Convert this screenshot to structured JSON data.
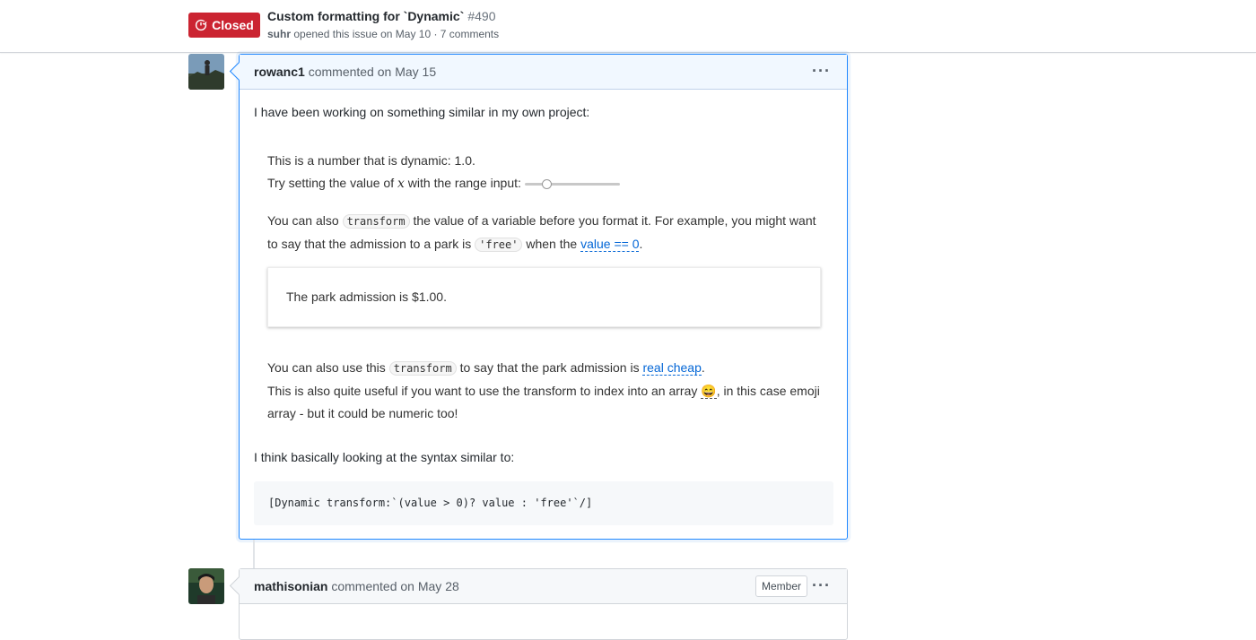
{
  "header": {
    "state": "Closed",
    "title": "Custom formatting for `Dynamic`",
    "number": "#490",
    "author": "suhr",
    "meta_rest": "opened this issue on May 10 · 7 comments"
  },
  "comments": [
    {
      "author": "rowanc1",
      "action": "commented on May 15",
      "intro": "I have been working on something similar in my own project:",
      "embed": {
        "line1": "This is a number that is dynamic: 1.0.",
        "line2_pre": "Try setting the value of ",
        "line2_var": "x",
        "line2_post": " with the range input:",
        "slider_value": 0.2,
        "p2_a": "You can also ",
        "p2_code1": "transform",
        "p2_b": " the value of a variable before you format it. For example, you might want to say that the admission to a park is ",
        "p2_code2": "'free'",
        "p2_c": " when the ",
        "p2_link": "value == 0",
        "p2_d": ".",
        "admission": "The park admission is $1.00.",
        "p3_a": "You can also use this ",
        "p3_code": "transform",
        "p3_b": " to say that the park admission is ",
        "p3_link": "real cheap",
        "p3_c": ".",
        "p4_a": "This is also quite useful if you want to use the transform to index into an array ",
        "p4_emoji": "😄",
        "p4_b": ", in this case emoji array - but it could be numeric too!"
      },
      "syntax_intro": "I think basically looking at the syntax similar to:",
      "code": "[Dynamic transform:`(value > 0)? value : 'free'`/]"
    },
    {
      "author": "mathisonian",
      "action": "commented on May 28",
      "badge": "Member"
    }
  ],
  "colors": {
    "closed": "#cb2431",
    "link": "#0366d6",
    "highlight_border": "#2188ff"
  }
}
